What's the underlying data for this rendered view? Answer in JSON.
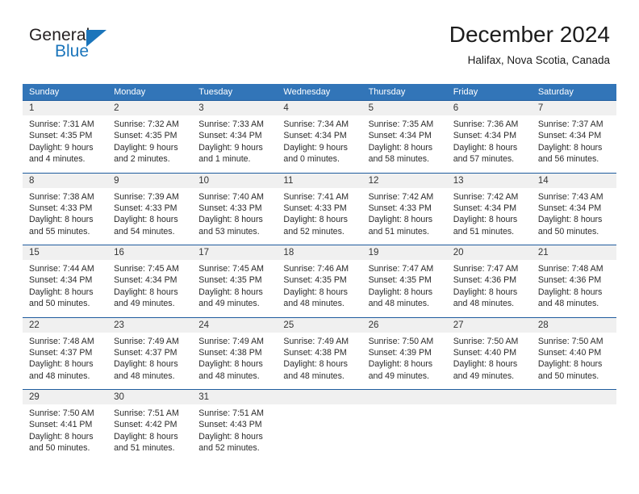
{
  "brand": {
    "name_part1": "General",
    "name_part2": "Blue",
    "logo_icon": "triangle-icon",
    "colors": {
      "blue": "#1b75bb",
      "dark": "#231f20"
    }
  },
  "header": {
    "title": "December 2024",
    "location": "Halifax, Nova Scotia, Canada"
  },
  "theme": {
    "header_blue": "#3275b8",
    "row_separator_blue": "#1f5c9e",
    "day_band_gray": "#f0f0f0"
  },
  "weekdays": [
    "Sunday",
    "Monday",
    "Tuesday",
    "Wednesday",
    "Thursday",
    "Friday",
    "Saturday"
  ],
  "weeks": [
    [
      {
        "day": "1",
        "sunrise": "Sunrise: 7:31 AM",
        "sunset": "Sunset: 4:35 PM",
        "daylight1": "Daylight: 9 hours",
        "daylight2": "and 4 minutes."
      },
      {
        "day": "2",
        "sunrise": "Sunrise: 7:32 AM",
        "sunset": "Sunset: 4:35 PM",
        "daylight1": "Daylight: 9 hours",
        "daylight2": "and 2 minutes."
      },
      {
        "day": "3",
        "sunrise": "Sunrise: 7:33 AM",
        "sunset": "Sunset: 4:34 PM",
        "daylight1": "Daylight: 9 hours",
        "daylight2": "and 1 minute."
      },
      {
        "day": "4",
        "sunrise": "Sunrise: 7:34 AM",
        "sunset": "Sunset: 4:34 PM",
        "daylight1": "Daylight: 9 hours",
        "daylight2": "and 0 minutes."
      },
      {
        "day": "5",
        "sunrise": "Sunrise: 7:35 AM",
        "sunset": "Sunset: 4:34 PM",
        "daylight1": "Daylight: 8 hours",
        "daylight2": "and 58 minutes."
      },
      {
        "day": "6",
        "sunrise": "Sunrise: 7:36 AM",
        "sunset": "Sunset: 4:34 PM",
        "daylight1": "Daylight: 8 hours",
        "daylight2": "and 57 minutes."
      },
      {
        "day": "7",
        "sunrise": "Sunrise: 7:37 AM",
        "sunset": "Sunset: 4:34 PM",
        "daylight1": "Daylight: 8 hours",
        "daylight2": "and 56 minutes."
      }
    ],
    [
      {
        "day": "8",
        "sunrise": "Sunrise: 7:38 AM",
        "sunset": "Sunset: 4:33 PM",
        "daylight1": "Daylight: 8 hours",
        "daylight2": "and 55 minutes."
      },
      {
        "day": "9",
        "sunrise": "Sunrise: 7:39 AM",
        "sunset": "Sunset: 4:33 PM",
        "daylight1": "Daylight: 8 hours",
        "daylight2": "and 54 minutes."
      },
      {
        "day": "10",
        "sunrise": "Sunrise: 7:40 AM",
        "sunset": "Sunset: 4:33 PM",
        "daylight1": "Daylight: 8 hours",
        "daylight2": "and 53 minutes."
      },
      {
        "day": "11",
        "sunrise": "Sunrise: 7:41 AM",
        "sunset": "Sunset: 4:33 PM",
        "daylight1": "Daylight: 8 hours",
        "daylight2": "and 52 minutes."
      },
      {
        "day": "12",
        "sunrise": "Sunrise: 7:42 AM",
        "sunset": "Sunset: 4:33 PM",
        "daylight1": "Daylight: 8 hours",
        "daylight2": "and 51 minutes."
      },
      {
        "day": "13",
        "sunrise": "Sunrise: 7:42 AM",
        "sunset": "Sunset: 4:34 PM",
        "daylight1": "Daylight: 8 hours",
        "daylight2": "and 51 minutes."
      },
      {
        "day": "14",
        "sunrise": "Sunrise: 7:43 AM",
        "sunset": "Sunset: 4:34 PM",
        "daylight1": "Daylight: 8 hours",
        "daylight2": "and 50 minutes."
      }
    ],
    [
      {
        "day": "15",
        "sunrise": "Sunrise: 7:44 AM",
        "sunset": "Sunset: 4:34 PM",
        "daylight1": "Daylight: 8 hours",
        "daylight2": "and 50 minutes."
      },
      {
        "day": "16",
        "sunrise": "Sunrise: 7:45 AM",
        "sunset": "Sunset: 4:34 PM",
        "daylight1": "Daylight: 8 hours",
        "daylight2": "and 49 minutes."
      },
      {
        "day": "17",
        "sunrise": "Sunrise: 7:45 AM",
        "sunset": "Sunset: 4:35 PM",
        "daylight1": "Daylight: 8 hours",
        "daylight2": "and 49 minutes."
      },
      {
        "day": "18",
        "sunrise": "Sunrise: 7:46 AM",
        "sunset": "Sunset: 4:35 PM",
        "daylight1": "Daylight: 8 hours",
        "daylight2": "and 48 minutes."
      },
      {
        "day": "19",
        "sunrise": "Sunrise: 7:47 AM",
        "sunset": "Sunset: 4:35 PM",
        "daylight1": "Daylight: 8 hours",
        "daylight2": "and 48 minutes."
      },
      {
        "day": "20",
        "sunrise": "Sunrise: 7:47 AM",
        "sunset": "Sunset: 4:36 PM",
        "daylight1": "Daylight: 8 hours",
        "daylight2": "and 48 minutes."
      },
      {
        "day": "21",
        "sunrise": "Sunrise: 7:48 AM",
        "sunset": "Sunset: 4:36 PM",
        "daylight1": "Daylight: 8 hours",
        "daylight2": "and 48 minutes."
      }
    ],
    [
      {
        "day": "22",
        "sunrise": "Sunrise: 7:48 AM",
        "sunset": "Sunset: 4:37 PM",
        "daylight1": "Daylight: 8 hours",
        "daylight2": "and 48 minutes."
      },
      {
        "day": "23",
        "sunrise": "Sunrise: 7:49 AM",
        "sunset": "Sunset: 4:37 PM",
        "daylight1": "Daylight: 8 hours",
        "daylight2": "and 48 minutes."
      },
      {
        "day": "24",
        "sunrise": "Sunrise: 7:49 AM",
        "sunset": "Sunset: 4:38 PM",
        "daylight1": "Daylight: 8 hours",
        "daylight2": "and 48 minutes."
      },
      {
        "day": "25",
        "sunrise": "Sunrise: 7:49 AM",
        "sunset": "Sunset: 4:38 PM",
        "daylight1": "Daylight: 8 hours",
        "daylight2": "and 48 minutes."
      },
      {
        "day": "26",
        "sunrise": "Sunrise: 7:50 AM",
        "sunset": "Sunset: 4:39 PM",
        "daylight1": "Daylight: 8 hours",
        "daylight2": "and 49 minutes."
      },
      {
        "day": "27",
        "sunrise": "Sunrise: 7:50 AM",
        "sunset": "Sunset: 4:40 PM",
        "daylight1": "Daylight: 8 hours",
        "daylight2": "and 49 minutes."
      },
      {
        "day": "28",
        "sunrise": "Sunrise: 7:50 AM",
        "sunset": "Sunset: 4:40 PM",
        "daylight1": "Daylight: 8 hours",
        "daylight2": "and 50 minutes."
      }
    ],
    [
      {
        "day": "29",
        "sunrise": "Sunrise: 7:50 AM",
        "sunset": "Sunset: 4:41 PM",
        "daylight1": "Daylight: 8 hours",
        "daylight2": "and 50 minutes."
      },
      {
        "day": "30",
        "sunrise": "Sunrise: 7:51 AM",
        "sunset": "Sunset: 4:42 PM",
        "daylight1": "Daylight: 8 hours",
        "daylight2": "and 51 minutes."
      },
      {
        "day": "31",
        "sunrise": "Sunrise: 7:51 AM",
        "sunset": "Sunset: 4:43 PM",
        "daylight1": "Daylight: 8 hours",
        "daylight2": "and 52 minutes."
      },
      {
        "day": "",
        "sunrise": "",
        "sunset": "",
        "daylight1": "",
        "daylight2": ""
      },
      {
        "day": "",
        "sunrise": "",
        "sunset": "",
        "daylight1": "",
        "daylight2": ""
      },
      {
        "day": "",
        "sunrise": "",
        "sunset": "",
        "daylight1": "",
        "daylight2": ""
      },
      {
        "day": "",
        "sunrise": "",
        "sunset": "",
        "daylight1": "",
        "daylight2": ""
      }
    ]
  ]
}
